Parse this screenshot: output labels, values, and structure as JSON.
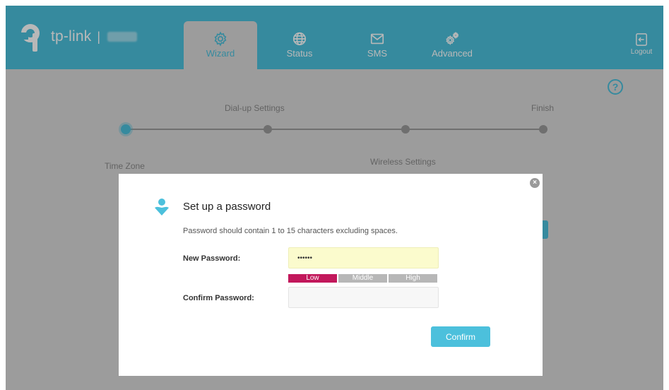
{
  "brand": {
    "name": "tp-link",
    "separator": "|"
  },
  "nav": {
    "tabs": [
      {
        "label": "Wizard",
        "icon": "gear-icon",
        "active": true
      },
      {
        "label": "Status",
        "icon": "globe-icon",
        "active": false
      },
      {
        "label": "SMS",
        "icon": "envelope-icon",
        "active": false
      },
      {
        "label": "Advanced",
        "icon": "gears-icon",
        "active": false
      }
    ],
    "logout_label": "Logout"
  },
  "wizard": {
    "help_icon": "?",
    "steps": [
      {
        "label": "Time Zone",
        "current": true
      },
      {
        "label": "Dial-up Settings",
        "current": false
      },
      {
        "label": "Wireless Settings",
        "current": false
      },
      {
        "label": "Finish",
        "current": false
      }
    ]
  },
  "modal": {
    "close_glyph": "×",
    "title": "Set up a password",
    "description": "Password should contain 1 to 15 characters excluding spaces.",
    "new_password": {
      "label": "New Password:",
      "value": "••••••"
    },
    "strength": {
      "labels": [
        "Low",
        "Middle",
        "High"
      ],
      "level": "Low"
    },
    "confirm_password": {
      "label": "Confirm Password:",
      "value": ""
    },
    "confirm_button": "Confirm"
  },
  "colors": {
    "accent": "#4cc0dc",
    "strength_low": "#c2185b",
    "strength_inactive": "#b7b7b7",
    "password_field_bg": "#fbfbcd"
  }
}
